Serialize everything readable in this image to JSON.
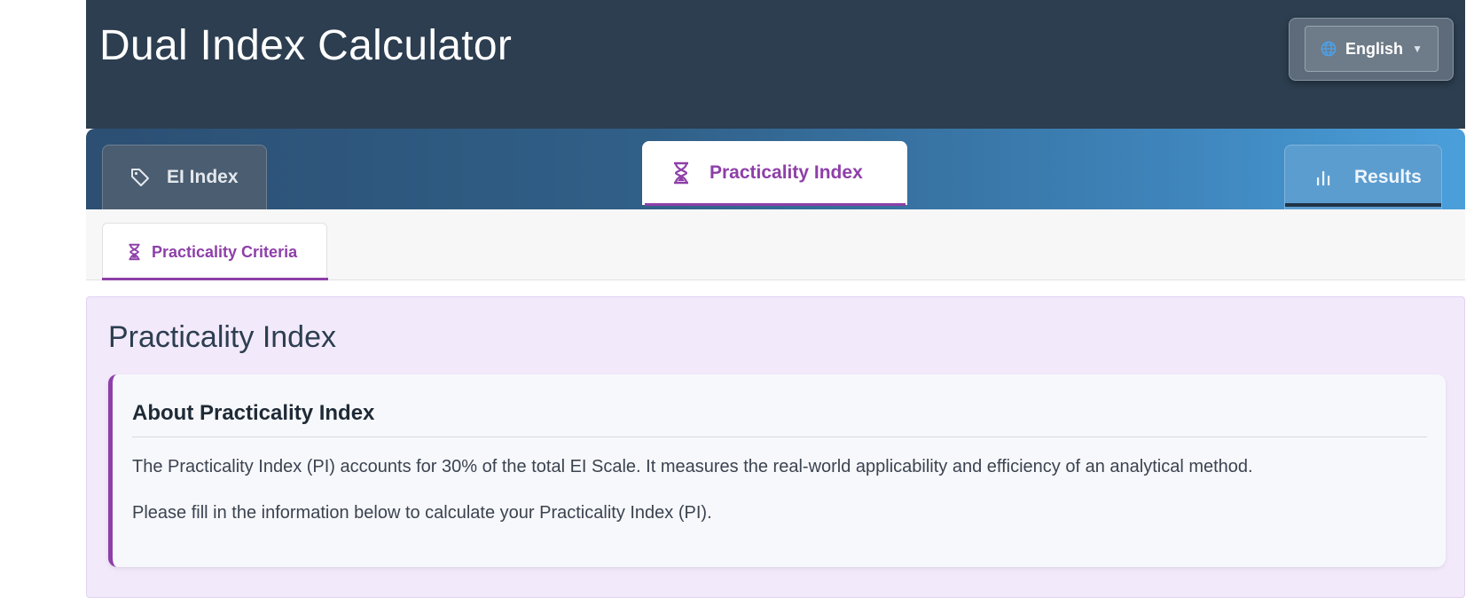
{
  "header": {
    "title": "Dual Index Calculator",
    "language": {
      "label": "English",
      "icon": "globe-icon",
      "caret": "chevron-down-icon"
    }
  },
  "tabs": [
    {
      "label": "EI Index",
      "icon": "tag-icon",
      "active": false
    },
    {
      "label": "Practicality Index",
      "icon": "hourglass-icon",
      "active": true
    },
    {
      "label": "Results",
      "icon": "bar-chart-icon",
      "active": false
    }
  ],
  "subtabs": [
    {
      "label": "Practicality Criteria",
      "icon": "hourglass-icon",
      "active": true
    }
  ],
  "panel": {
    "title": "Practicality Index",
    "about": {
      "title": "About Practicality Index",
      "paragraph1": "The Practicality Index (PI) accounts for 30% of the total EI Scale. It measures the real-world applicability and efficiency of an analytical method.",
      "paragraph2": "Please fill in the information below to calculate your Practicality Index (PI)."
    }
  },
  "colors": {
    "header_bg": "#2c3e50",
    "accent_purple": "#8e3fa8",
    "panel_bg": "#f2e9fb"
  }
}
